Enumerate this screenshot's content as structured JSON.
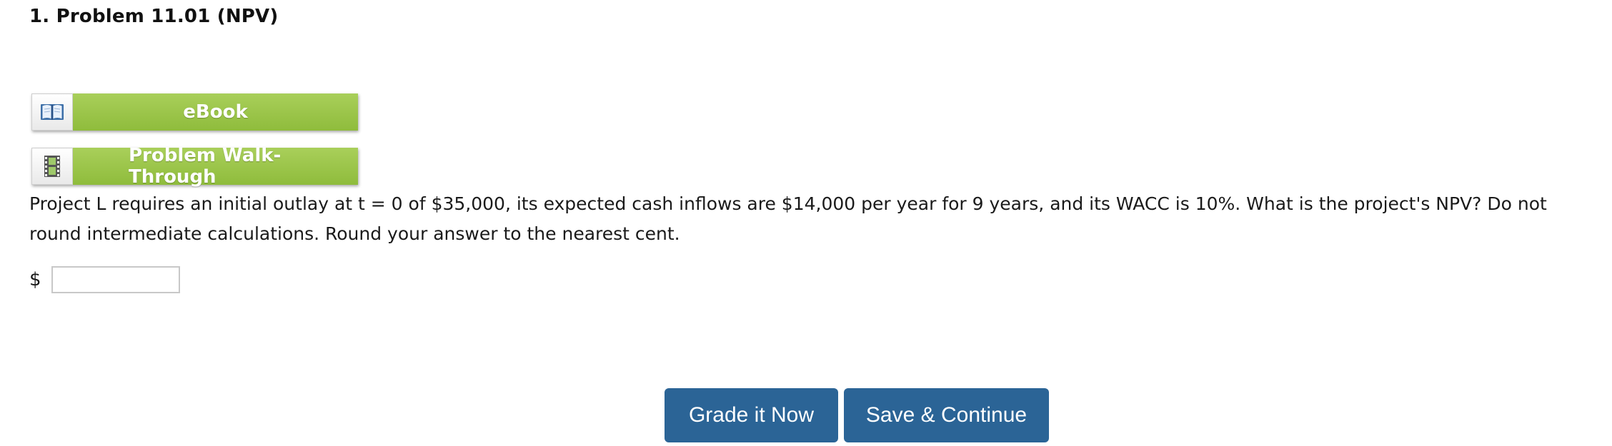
{
  "problem": {
    "title": "1.  Problem 11.01 (NPV)"
  },
  "resources": {
    "ebook_label": "eBook",
    "walkthrough_label": "Problem Walk-Through"
  },
  "question": {
    "text": "Project L requires an initial outlay at t = 0 of $35,000, its expected cash inflows are $14,000 per year for 9 years, and its WACC is 10%. What is the project's NPV? Do not round intermediate calculations. Round your answer to the nearest cent."
  },
  "answer": {
    "currency_symbol": "$",
    "value": ""
  },
  "actions": {
    "grade_label": "Grade it Now",
    "save_label": "Save & Continue"
  },
  "colors": {
    "resource_green": "#9bc54a",
    "action_blue": "#2b6496"
  },
  "icons": {
    "ebook": "book-icon",
    "walkthrough": "film-icon"
  }
}
